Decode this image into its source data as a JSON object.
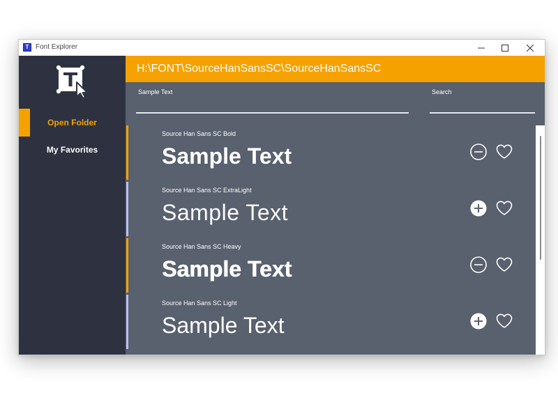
{
  "window": {
    "title": "Font Explorer",
    "app_icon": "font-explorer-app-icon",
    "controls": [
      "minimize-icon",
      "maximize-icon",
      "close-icon"
    ]
  },
  "sidebar": {
    "logo_icon": "text-cursor-logo-icon",
    "items": [
      {
        "label": "Open Folder",
        "active": true
      },
      {
        "label": "My Favorites",
        "active": false
      }
    ]
  },
  "header": {
    "path": "H:\\FONT\\SourceHanSansSC\\SourceHanSansSC"
  },
  "fields": {
    "sample_text": {
      "label": "Sample Text",
      "value": ""
    },
    "search": {
      "label": "Search",
      "value": ""
    }
  },
  "fonts": [
    {
      "name": "Source Han Sans SC Bold",
      "sample": "Sample Text",
      "selected": true,
      "action_icon": "minus-circle-icon",
      "favorite_icon": "heart-outline-icon"
    },
    {
      "name": "Source Han Sans SC ExtraLight",
      "sample": "Sample Text",
      "selected": false,
      "action_icon": "plus-circle-icon",
      "favorite_icon": "heart-outline-icon"
    },
    {
      "name": "Source Han Sans SC Heavy",
      "sample": "Sample Text",
      "selected": true,
      "action_icon": "minus-circle-icon",
      "favorite_icon": "heart-outline-icon"
    },
    {
      "name": "Source Han Sans SC Light",
      "sample": "Sample Text",
      "selected": false,
      "action_icon": "plus-circle-icon",
      "favorite_icon": "heart-outline-icon"
    }
  ],
  "colors": {
    "accent": "#f5a200",
    "sidebar": "#2e3240",
    "content": "#59606e",
    "unselected_bar": "#b8bff0"
  }
}
